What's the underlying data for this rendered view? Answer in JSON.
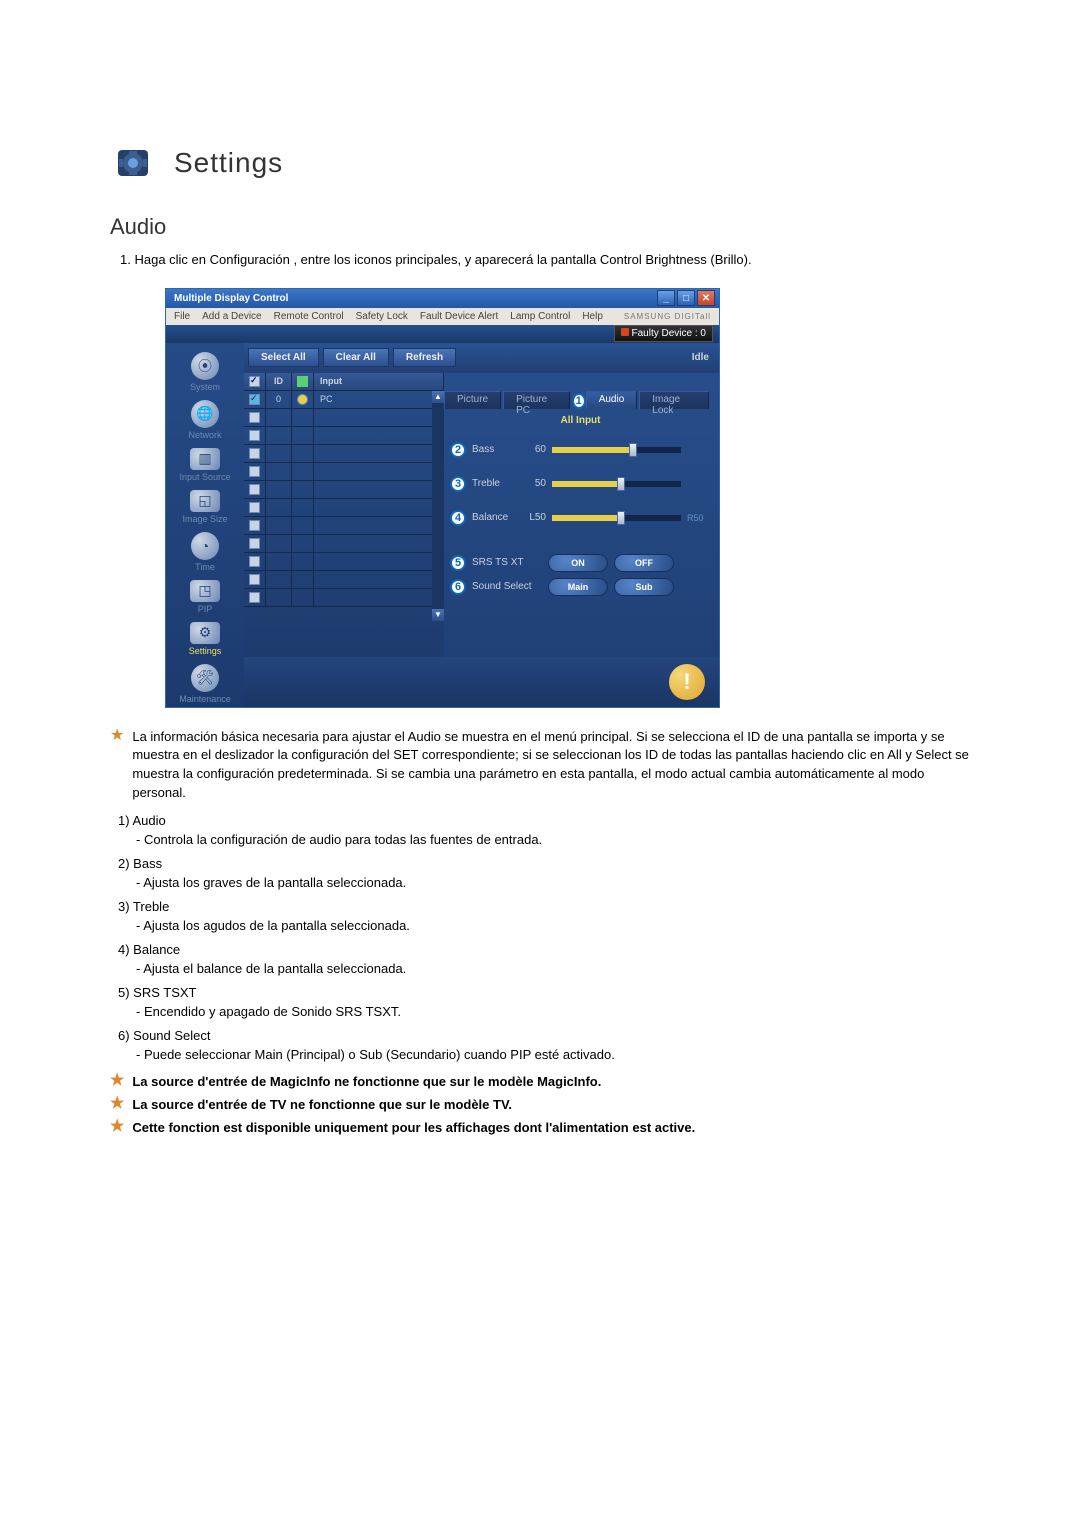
{
  "heading": {
    "title": "Settings"
  },
  "subheading": {
    "title": "Audio"
  },
  "intro": {
    "line1_prefix": "1.",
    "line1": "Haga clic en Configuración , entre los iconos principales, y aparecerá la pantalla Control Brightness (Brillo)."
  },
  "app": {
    "titlebar": "Multiple Display Control",
    "menu": {
      "file": "File",
      "add_device": "Add a Device",
      "remote_control": "Remote Control",
      "safety_lock": "Safety Lock",
      "fault_device_alert": "Fault Device Alert",
      "lamp_control": "Lamp Control",
      "help": "Help"
    },
    "brand": "SAMSUNG DIGITall",
    "faulty": "Faulty Device : 0",
    "toolbar": {
      "select_all": "Select All",
      "clear_all": "Clear All",
      "refresh": "Refresh",
      "idle": "Idle"
    },
    "sidebar": {
      "system": "System",
      "network": "Network",
      "input_source": "Input Source",
      "image_size": "Image Size",
      "time": "Time",
      "pip": "PIP",
      "settings": "Settings",
      "maintenance": "Maintenance"
    },
    "tabs": {
      "picture": "Picture",
      "picture_pc": "Picture PC",
      "audio": "Audio",
      "image_lock": "Image Lock"
    },
    "num1": "1",
    "table": {
      "id_col": "ID",
      "input_col": "Input",
      "rows": [
        {
          "id": "0",
          "input": "PC"
        }
      ]
    },
    "panel": {
      "all_input": "All Input",
      "bass": {
        "num": "2",
        "label": "Bass",
        "value": "60"
      },
      "treble": {
        "num": "3",
        "label": "Treble",
        "value": "50"
      },
      "balance": {
        "num": "4",
        "label": "Balance",
        "left": "L50",
        "right": "R50"
      },
      "srs": {
        "num": "5",
        "label": "SRS TS XT",
        "on": "ON",
        "off": "OFF"
      },
      "sound_select": {
        "num": "6",
        "label": "Sound Select",
        "main": "Main",
        "sub": "Sub"
      }
    }
  },
  "desc": {
    "star1": "La información básica necesaria para ajustar el Audio se muestra en el menú principal. Si se selecciona el ID de una pantalla se importa y se muestra en el deslizador la configuración del SET correspondiente; si se seleccionan los ID de todas las pantallas haciendo clic en All y Select se muestra la configuración predeterminada. Si se cambia una parámetro en esta pantalla, el modo actual cambia automáticamente al modo personal.",
    "i1_t": "1)  Audio",
    "i1_d": "- Controla la configuración de audio para todas las fuentes de entrada.",
    "i2_t": "2)  Bass",
    "i2_d": "- Ajusta los graves de la pantalla seleccionada.",
    "i3_t": "3)  Treble",
    "i3_d": "- Ajusta los agudos de la pantalla seleccionada.",
    "i4_t": "4)  Balance",
    "i4_d": "- Ajusta el balance de la pantalla seleccionada.",
    "i5_t": "5)  SRS TSXT",
    "i5_d": "- Encendido y apagado de Sonido SRS TSXT.",
    "i6_t": "6)  Sound Select",
    "i6_d": "- Puede seleccionar Main (Principal) o Sub (Secundario) cuando PIP esté activado.",
    "star2": "La source d'entrée de MagicInfo ne fonctionne que sur le modèle MagicInfo.",
    "star3": "La source d'entrée de TV ne fonctionne que sur le modèle TV.",
    "star4": "Cette fonction est disponible uniquement pour les affichages dont l'alimentation est active."
  }
}
